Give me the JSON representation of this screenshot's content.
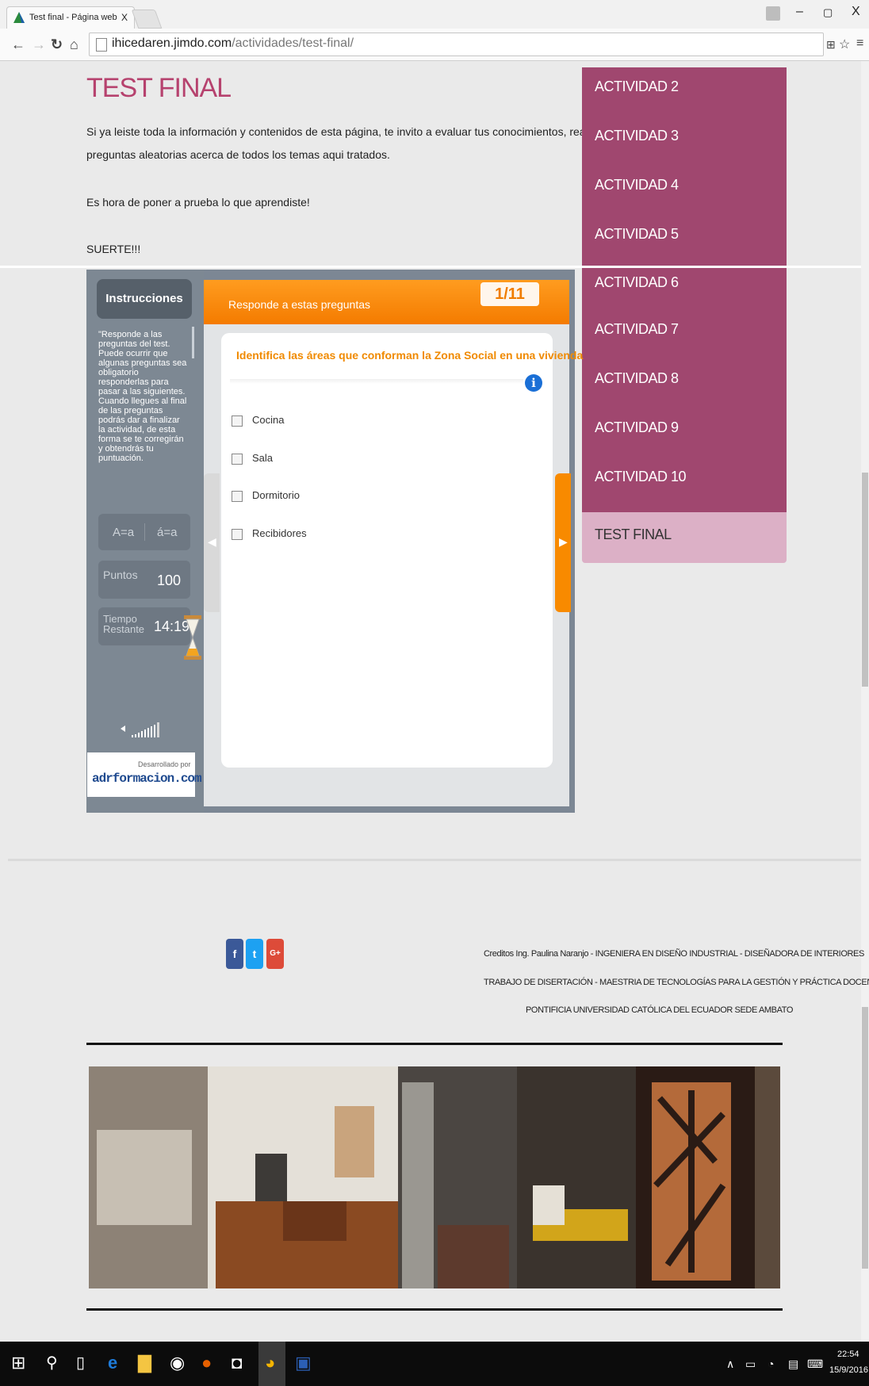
{
  "browser": {
    "tab_title": "Test final - Página web de",
    "tab_close": "X",
    "window_controls": [
      "–",
      "▢",
      "X"
    ],
    "url_domain": "ihicedaren.jimdo.com",
    "url_path": "/actividades/test-final/"
  },
  "page": {
    "title": "TEST FINAL",
    "para1_line1": "Si ya leiste toda la información y contenidos de esta página,  te invito a evaluar tus conocimientos, realiza este Test que contiene",
    "para1_line2": "preguntas aleatorias acerca de todos los temas aqui tratados.",
    "para2": "Es hora de poner a prueba lo que aprendiste!",
    "para3": "SUERTE!!!"
  },
  "nav": {
    "items": [
      {
        "label": "ACTIVIDAD 2"
      },
      {
        "label": "ACTIVIDAD 3"
      },
      {
        "label": "ACTIVIDAD 4"
      },
      {
        "label": "ACTIVIDAD 5"
      },
      {
        "label": "ACTIVIDAD 6"
      },
      {
        "label": "ACTIVIDAD 7"
      },
      {
        "label": "ACTIVIDAD 8"
      },
      {
        "label": "ACTIVIDAD 9"
      },
      {
        "label": "ACTIVIDAD 10"
      },
      {
        "label": "TEST FINAL"
      }
    ],
    "active_index": 9
  },
  "quiz": {
    "instructions_label": "Instrucciones",
    "instructions_text": "\"Responde a las preguntas del test. Puede ocurrir que algunas preguntas sea obligatorio responderlas para pasar a las siguientes. Cuando llegues al final de las preguntas podrás dar a finalizar la actividad, de esta forma se te corregirán y obtendrás tu puntuación.",
    "font_small": "A=a",
    "font_accent": "á=a",
    "points_label": "Puntos",
    "points_value": "100",
    "time_label_1": "Tiempo",
    "time_label_2": "Restante",
    "time_value": "14:19",
    "header": "Responde a estas preguntas",
    "counter": "1/11",
    "question": "Identifica las áreas que conforman la Zona Social en una vivienda",
    "options": [
      "Cocina",
      "Sala",
      "Dormitorio",
      "Recibidores"
    ],
    "dev_by": "Desarrollado por",
    "dev_brand": "adrformacion.com"
  },
  "footer": {
    "social": [
      "f",
      "t",
      "G+"
    ],
    "credit_line1": "Creditos Ing. Paulina Naranjo - INGENIERA EN DISEÑO INDUSTRIAL - DISEÑADORA DE INTERIORES",
    "credit_line2": "TRABAJO DE DISERTACIÓN - MAESTRIA DE TECNOLOGÍAS PARA LA GESTIÓN Y PRÁCTICA DOCENTE",
    "credit_line3": "PONTIFICIA UNIVERSIDAD CATÓLICA DEL ECUADOR SEDE AMBATO"
  },
  "taskbar": {
    "time": "22:54",
    "date": "15/9/2016"
  },
  "colors": {
    "accent_pink": "#a0476f",
    "active_nav": "#dcb0c6",
    "quiz_orange": "#f47b00",
    "facebook": "#3b5998",
    "twitter": "#1da1f2",
    "google": "#dd4b39"
  }
}
